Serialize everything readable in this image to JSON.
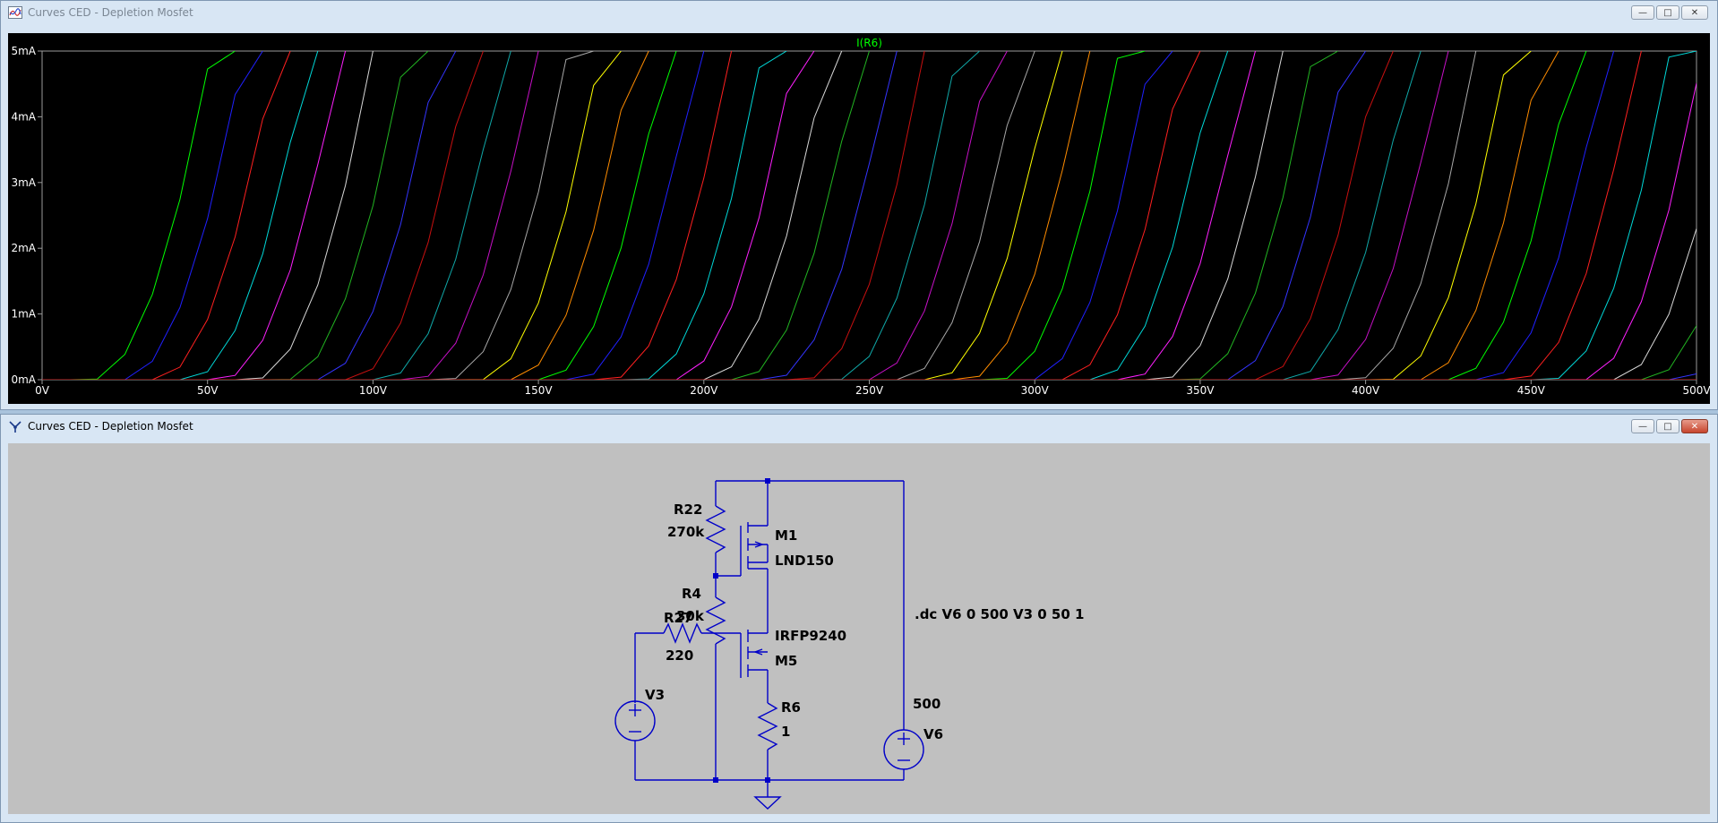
{
  "plot_window": {
    "title": "Curves CED - Depletion Mosfet",
    "icon": "waveform-icon",
    "minimize_label": "—",
    "maximize_label": "□",
    "close_label": "✕"
  },
  "schematic_window": {
    "title": "Curves CED - Depletion Mosfet",
    "icon": "schematic-icon",
    "minimize_label": "—",
    "maximize_label": "□",
    "close_label": "✕"
  },
  "chart_data": {
    "type": "line",
    "title": "I(R6)",
    "xlabel": "",
    "ylabel": "",
    "xlim": [
      0,
      500
    ],
    "ylim": [
      0,
      5
    ],
    "x_ticks": [
      "0V",
      "50V",
      "100V",
      "150V",
      "200V",
      "250V",
      "300V",
      "350V",
      "400V",
      "450V",
      "500V"
    ],
    "y_ticks": [
      "0mA",
      "1mA",
      "2mA",
      "3mA",
      "4mA",
      "5mA"
    ],
    "grid": false,
    "background": "#000000",
    "series_colors": [
      "#00ff00",
      "#2020ff",
      "#ff2020",
      "#00d8d8",
      "#ff20ff",
      "#d8d8d8",
      "#22b522",
      "#3434ff",
      "#c81010",
      "#10a8a8",
      "#c810c8",
      "#a8a8a8",
      "#ffff00",
      "#ff8c00"
    ],
    "series_count": 51,
    "curve_onset_v_first": 15,
    "onset_step_v": 9.8,
    "reach_5mA_offset_v": 36
  },
  "schematic": {
    "directive": ".dc V6 0 500  V3 0 50 1",
    "R22": {
      "name": "R22",
      "value": "270k"
    },
    "R4": {
      "name": "R4",
      "value": "30k"
    },
    "R27": {
      "name": "R27",
      "value": "220"
    },
    "R6": {
      "name": "R6",
      "value": "1"
    },
    "M1": {
      "name": "M1",
      "model": "LND150"
    },
    "M5": {
      "name": "M5",
      "model": "IRFP9240"
    },
    "V3": {
      "name": "V3"
    },
    "V6": {
      "name": "V6",
      "value": "500"
    },
    "wire_color": "#0000c8"
  }
}
